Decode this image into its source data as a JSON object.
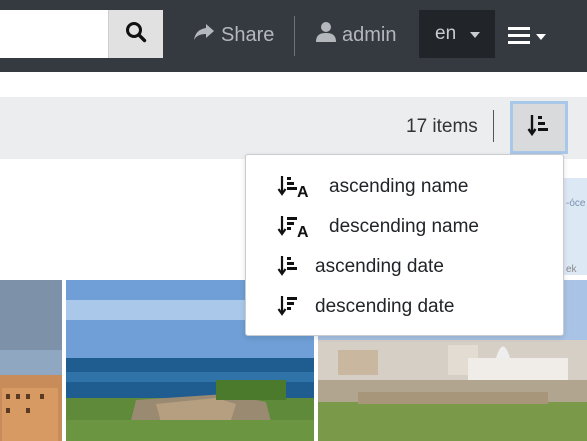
{
  "navbar": {
    "search": {
      "value": "",
      "placeholder": ""
    },
    "share_label": "Share",
    "user_label": "admin",
    "language": "en"
  },
  "toolbar": {
    "item_count": "17 items"
  },
  "sort_menu": {
    "options": [
      {
        "label": "ascending name",
        "icon": "sort-alpha-asc-icon"
      },
      {
        "label": "descending name",
        "icon": "sort-alpha-desc-icon"
      },
      {
        "label": "ascending date",
        "icon": "sort-amount-asc-icon"
      },
      {
        "label": "descending date",
        "icon": "sort-amount-desc-icon"
      }
    ]
  },
  "side_widget": {
    "text_top": "-óce",
    "text_bottom": "ek"
  },
  "colors": {
    "navbar_bg": "#343a40",
    "toolbar_bg": "#ebedef",
    "sort_button_border": "#a9c7e8"
  }
}
